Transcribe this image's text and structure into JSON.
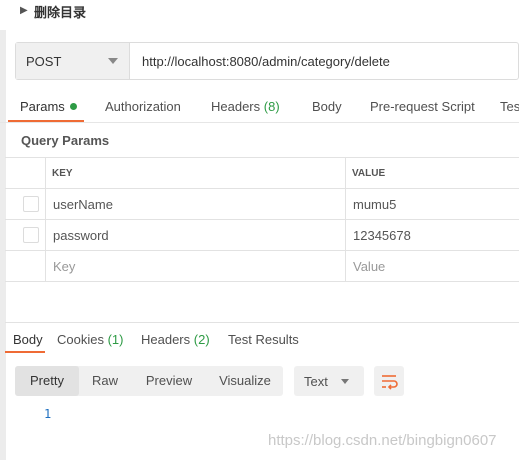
{
  "section": {
    "title": "删除目录"
  },
  "request": {
    "method": "POST",
    "url": "http://localhost:8080/admin/category/delete"
  },
  "tabs": [
    {
      "label": "Params"
    },
    {
      "label": "Authorization"
    },
    {
      "label": "Headers",
      "count": "(8)"
    },
    {
      "label": "Body"
    },
    {
      "label": "Pre-request Script"
    },
    {
      "label": "Tes"
    }
  ],
  "query_params": {
    "title": "Query Params",
    "headers": {
      "key": "KEY",
      "value": "VALUE"
    },
    "rows": [
      {
        "key": "userName",
        "value": "mumu5"
      },
      {
        "key": "password",
        "value": "12345678"
      }
    ],
    "placeholder": {
      "key": "Key",
      "value": "Value"
    }
  },
  "response_tabs": [
    {
      "label": "Body"
    },
    {
      "label": "Cookies",
      "count": "(1)"
    },
    {
      "label": "Headers",
      "count": "(2)"
    },
    {
      "label": "Test Results"
    }
  ],
  "view_modes": [
    "Pretty",
    "Raw",
    "Preview",
    "Visualize"
  ],
  "format": "Text",
  "response_body": {
    "line_number": "1"
  },
  "watermark": "https://blog.csdn.net/bingbign0607",
  "colors": {
    "accent": "#ef6b35",
    "success": "#2e9b45",
    "line_number": "#1e6fc0"
  }
}
